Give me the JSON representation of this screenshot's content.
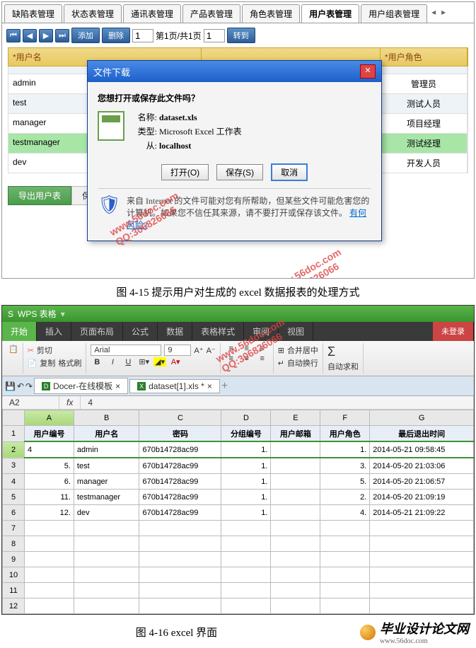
{
  "fig1": {
    "tabs": [
      "缺陷表管理",
      "状态表管理",
      "通讯表管理",
      "产品表管理",
      "角色表管理",
      "用户表管理",
      "用户组表管理"
    ],
    "activeTab": 5,
    "toolbar": {
      "add": "添加",
      "del": "删除",
      "pagetext": "第1页/共1页",
      "pagebox": "1",
      "go": "转到",
      "pnum": "1"
    },
    "headers": {
      "c1": "*用户名",
      "c3": "*用户角色"
    },
    "rows": [
      {
        "name": "",
        "role": ""
      },
      {
        "name": "admin",
        "role": "管理员"
      },
      {
        "name": "test",
        "role": "测试人员"
      },
      {
        "name": "manager",
        "role": "项目经理"
      },
      {
        "name": "testmanager",
        "role": "测试经理"
      },
      {
        "name": "dev",
        "role": "开发人员"
      }
    ],
    "bottabs": {
      "export": "导出用户表",
      "save": "保存"
    }
  },
  "dialog": {
    "title": "文件下载",
    "question": "您想打开或保存此文件吗？",
    "name_lbl": "名称:",
    "name": "dataset.xls",
    "type_lbl": "类型:",
    "type": "Microsoft Excel 工作表",
    "from_lbl": "从:",
    "from": "localhost",
    "open": "打开(O)",
    "save": "保存(S)",
    "cancel": "取消",
    "warn": "来自 Internet 的文件可能对您有所帮助，但某些文件可能危害您的计算机。如果您不信任其来源，请不要打开或保存该文件。",
    "risk": "有何风险?"
  },
  "cap1": "图 4-15  提示用户对生成的 excel 数据报表的处理方式",
  "wps": {
    "app": "WPS 表格",
    "menus": [
      "开始",
      "插入",
      "页面布局",
      "公式",
      "数据",
      "表格样式",
      "审阅",
      "视图"
    ],
    "login": "未登录",
    "clip": {
      "cut": "剪切",
      "copy": "复制",
      "fmt": "格式刷"
    },
    "font": {
      "name": "Arial",
      "size": "9"
    },
    "merge": "合并居中",
    "wrap": "自动换行",
    "sum": "自动求和",
    "docs": {
      "docer": "Docer-在线模板",
      "file": "dataset[1].xls *"
    },
    "cellref": "A2",
    "fx": "fx",
    "fval": "4",
    "cols": [
      "A",
      "B",
      "C",
      "D",
      "E",
      "F",
      "G"
    ],
    "hdr": [
      "用户编号",
      "用户名",
      "密码",
      "分组编号",
      "用户邮箱",
      "用户角色",
      "最后退出时间"
    ],
    "rows": [
      [
        "4",
        "admin",
        "670b14728ac99",
        "1.",
        "",
        "1.",
        "2014-05-21 09:58:45"
      ],
      [
        "5.",
        "test",
        "670b14728ac99",
        "1.",
        "",
        "3.",
        "2014-05-20 21:03:06"
      ],
      [
        "6.",
        "manager",
        "670b14728ac99",
        "1.",
        "",
        "5.",
        "2014-05-20 21:06:57"
      ],
      [
        "11.",
        "testmanager",
        "670b14728ac99",
        "1.",
        "",
        "2.",
        "2014-05-20 21:09:19"
      ],
      [
        "12.",
        "dev",
        "670b14728ac99",
        "1.",
        "",
        "4.",
        "2014-05-21 21:09:22"
      ]
    ]
  },
  "cap2": "图 4-16  excel 界面",
  "watermark": {
    "url": "www.56doc.com",
    "qq": "QQ:306826066"
  },
  "logo": {
    "name": "毕业设计论文网",
    "url": "www.56doc.com"
  }
}
